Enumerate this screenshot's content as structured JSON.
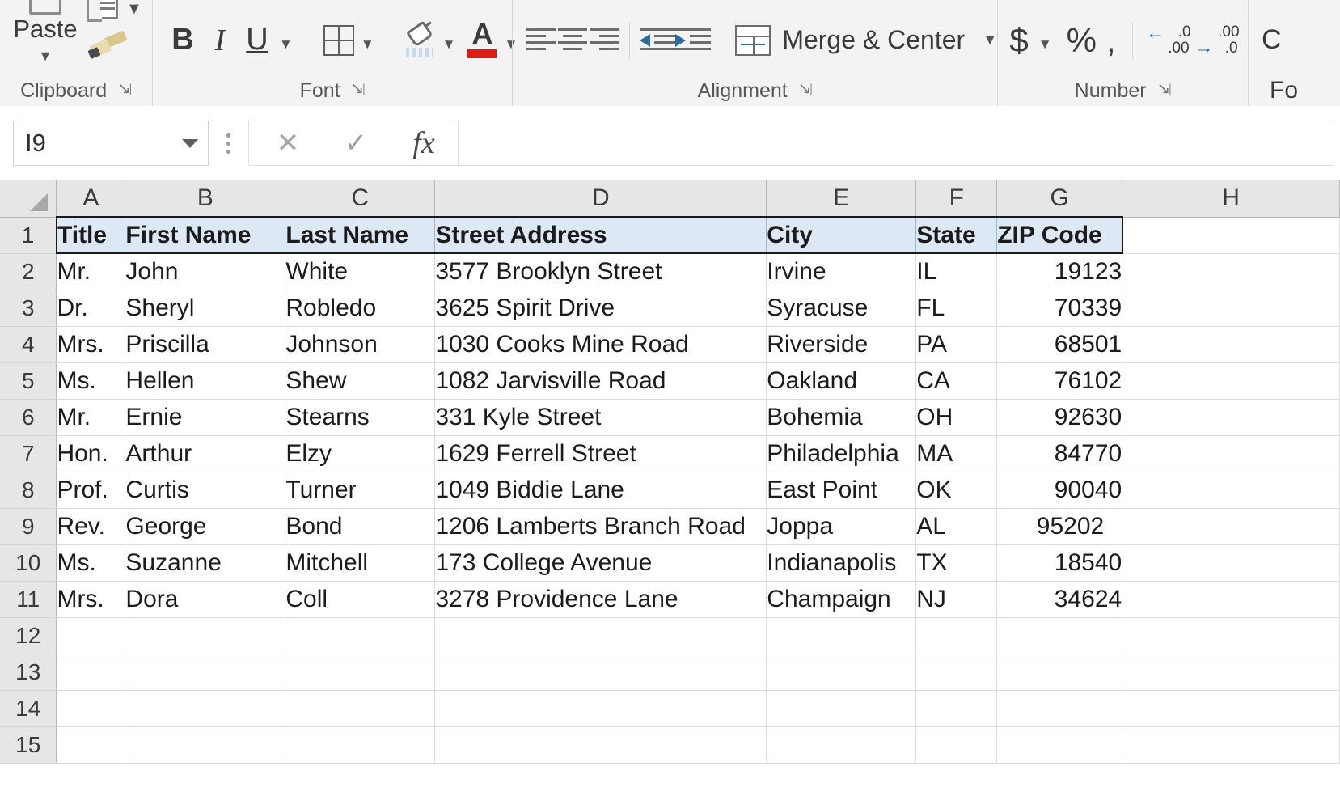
{
  "ribbon": {
    "groups": [
      {
        "name": "clipboard",
        "label": "Clipboard",
        "paste_label": "Paste"
      },
      {
        "name": "font",
        "label": "Font",
        "bold": "B",
        "italic": "I",
        "underline": "U",
        "font_color_letter": "A",
        "font_color_hex": "#e01b13"
      },
      {
        "name": "alignment",
        "label": "Alignment",
        "merge_label": "Merge & Center"
      },
      {
        "name": "number",
        "label": "Number",
        "currency": "$",
        "percent": "%",
        "comma": ",",
        "inc_dec_top": ".0",
        "inc_dec_bottom": ".00",
        "dec_dec_top": ".00",
        "dec_dec_bottom": ".0"
      },
      {
        "name": "styles",
        "label_partial": "C",
        "label_partial2": "Fo"
      }
    ]
  },
  "formula_bar": {
    "name_box_value": "I9",
    "cancel_icon": "✕",
    "confirm_icon": "✓",
    "function_icon": "fx",
    "formula_value": ""
  },
  "grid": {
    "column_headers": [
      "A",
      "B",
      "C",
      "D",
      "E",
      "F",
      "G",
      "H"
    ],
    "row_numbers": [
      "1",
      "2",
      "3",
      "4",
      "5",
      "6",
      "7",
      "8",
      "9",
      "10",
      "11",
      "12",
      "13",
      "14",
      "15"
    ],
    "selection_range": "A1:G1",
    "header_fill_hex": "#dce9f5",
    "table_headers": [
      "Title",
      "First Name",
      "Last Name",
      "Street Address",
      "City",
      "State",
      "ZIP Code"
    ],
    "rows": [
      {
        "row": "2",
        "title": "Mr.",
        "first": "John",
        "last": "White",
        "street": "3577 Brooklyn Street",
        "city": "Irvine",
        "state": "IL",
        "zip": "19123"
      },
      {
        "row": "3",
        "title": "Dr.",
        "first": "Sheryl",
        "last": "Robledo",
        "street": "3625 Spirit Drive",
        "city": "Syracuse",
        "state": "FL",
        "zip": "70339"
      },
      {
        "row": "4",
        "title": "Mrs.",
        "first": "Priscilla",
        "last": "Johnson",
        "street": "1030 Cooks Mine Road",
        "city": "Riverside",
        "state": "PA",
        "zip": "68501"
      },
      {
        "row": "5",
        "title": "Ms.",
        "first": "Hellen",
        "last": "Shew",
        "street": "1082 Jarvisville Road",
        "city": "Oakland",
        "state": "CA",
        "zip": "76102"
      },
      {
        "row": "6",
        "title": "Mr.",
        "first": "Ernie",
        "last": "Stearns",
        "street": "331 Kyle Street",
        "city": "Bohemia",
        "state": "OH",
        "zip": "92630"
      },
      {
        "row": "7",
        "title": "Hon.",
        "first": "Arthur",
        "last": "Elzy",
        "street": "1629 Ferrell Street",
        "city": "Philadelphia",
        "state": "MA",
        "zip": "84770"
      },
      {
        "row": "8",
        "title": "Prof.",
        "first": "Curtis",
        "last": "Turner",
        "street": "1049 Biddie Lane",
        "city": "East Point",
        "state": "OK",
        "zip": "90040"
      },
      {
        "row": "9",
        "title": "Rev.",
        "first": "George",
        "last": "Bond",
        "street": "1206 Lamberts Branch Road",
        "city": "Joppa",
        "state": "AL",
        "zip": "95202"
      },
      {
        "row": "10",
        "title": "Ms.",
        "first": "Suzanne",
        "last": "Mitchell",
        "street": "173 College Avenue",
        "city": "Indianapolis",
        "state": "TX",
        "zip": "18540"
      },
      {
        "row": "11",
        "title": "Mrs.",
        "first": "Dora",
        "last": "Coll",
        "street": "3278 Providence Lane",
        "city": "Champaign",
        "state": "NJ",
        "zip": "34624"
      },
      {
        "row": "12",
        "title": "",
        "first": "",
        "last": "",
        "street": "",
        "city": "",
        "state": "",
        "zip": ""
      },
      {
        "row": "13",
        "title": "",
        "first": "",
        "last": "",
        "street": "",
        "city": "",
        "state": "",
        "zip": ""
      },
      {
        "row": "14",
        "title": "",
        "first": "",
        "last": "",
        "street": "",
        "city": "",
        "state": "",
        "zip": ""
      },
      {
        "row": "15",
        "title": "",
        "first": "",
        "last": "",
        "street": "",
        "city": "",
        "state": "",
        "zip": ""
      }
    ]
  }
}
